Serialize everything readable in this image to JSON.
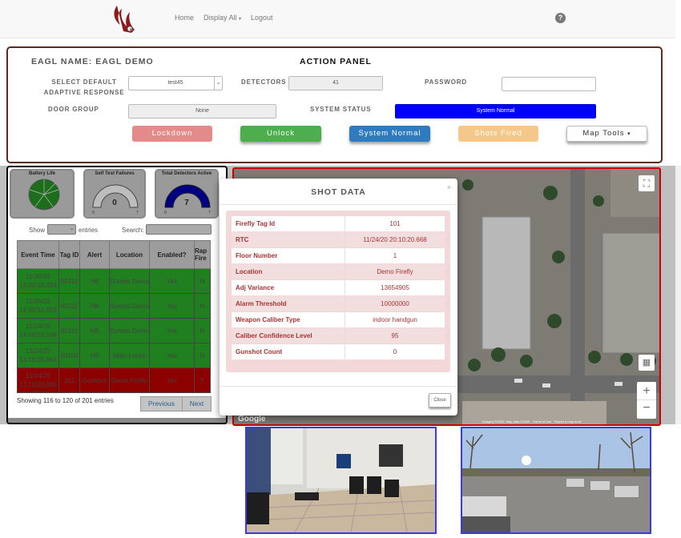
{
  "nav": {
    "home": "Home",
    "display_all": "Display All",
    "logout": "Logout",
    "help_icon": "?"
  },
  "action_panel": {
    "eagl_name": "EAGL NAME: EAGL DEMO",
    "title": "ACTION PANEL",
    "select_default_label": "SELECT DEFAULT ADAPTIVE RESPONSE",
    "select_default_value": "test45",
    "detectors_label": "DETECTORS",
    "detectors_value": "41",
    "password_label": "PASSWORD",
    "password_value": "",
    "door_group_label": "DOOR GROUP",
    "door_group_value": "None",
    "system_status_label": "SYSTEM STATUS",
    "system_status_value": "System Normal",
    "buttons": {
      "lockdown": "Lockdown",
      "unlock": "Unlock",
      "system_normal": "System Normal",
      "shots_fired": "Shots Fired",
      "map_tools": "Map Tools"
    }
  },
  "gauges": {
    "battery_life": "Battery Life",
    "self_test": "Self Test Failures",
    "self_test_value": "0",
    "self_test_min": "0",
    "self_test_max": "7",
    "total_detectors": "Total Detectors Active",
    "total_detectors_value": "7",
    "total_detectors_min": "0",
    "total_detectors_max": "7"
  },
  "table": {
    "show_label": "Show",
    "entries_label": "entries",
    "search_label": "Search:",
    "columns": [
      "Event Time",
      "Tag ID",
      "Alert",
      "Location",
      "Enabled?",
      "Rap Fire"
    ],
    "rows": [
      {
        "time": "11/30/20 14:09:18.394",
        "tag": "60111",
        "alert": "HB",
        "location": "Duress Demo",
        "enabled": "Yes",
        "rap": "N",
        "status": "green"
      },
      {
        "time": "11/25/20 14:09:52.553",
        "tag": "60111",
        "alert": "HB",
        "location": "Duress Demo",
        "enabled": "Yes",
        "rap": "N",
        "status": "green"
      },
      {
        "time": "11/24/20 14:09:53.248",
        "tag": "60111",
        "alert": "HB",
        "location": "Duress Demo",
        "enabled": "Yes",
        "rap": "N",
        "status": "green"
      },
      {
        "time": "11/24/20 13:18:35.964",
        "tag": "60100",
        "alert": "HB",
        "location": "Main Lobby",
        "enabled": "Yes",
        "rap": "N",
        "status": "green"
      },
      {
        "time": "11/24/20 13:10:20.668",
        "tag": "101",
        "alert": "Gunshot",
        "location": "Demo Firefly",
        "enabled": "Yes",
        "rap": "Y",
        "status": "red"
      }
    ],
    "info": "Showing 116 to 120 of 201 entries",
    "previous": "Previous",
    "next": "Next"
  },
  "modal": {
    "title": "SHOT DATA",
    "close_x": "×",
    "fields": [
      {
        "label": "Firefly Tag Id",
        "value": "101"
      },
      {
        "label": "RTC",
        "value": "11/24/20 20:10:20.668"
      },
      {
        "label": "Floor Number",
        "value": "1"
      },
      {
        "label": "Location",
        "value": "Demo Firefly"
      },
      {
        "label": "Adj Variance",
        "value": "13654905"
      },
      {
        "label": "Alarm Threshold",
        "value": "10000000"
      },
      {
        "label": "Weapon Caliber Type",
        "value": "indoor handgun"
      },
      {
        "label": "Caliber Confidence Level",
        "value": "95"
      },
      {
        "label": "Gunshot Count",
        "value": "0"
      }
    ],
    "close_button": "Close"
  },
  "map": {
    "google_label": "Google",
    "zoom_in": "+",
    "zoom_out": "−",
    "map_data_label": "Imagery ©2020, Map data ©2020 · Terms of Use · Report a map error"
  },
  "colors": {
    "system_normal": "#0000ff",
    "lockdown": "#e58a8a",
    "unlock": "#4cae4c",
    "status_blue": "#2f7bbf",
    "shots_fired": "#f5c88a",
    "alert_green": "#208020",
    "alert_red": "#8c0000"
  }
}
